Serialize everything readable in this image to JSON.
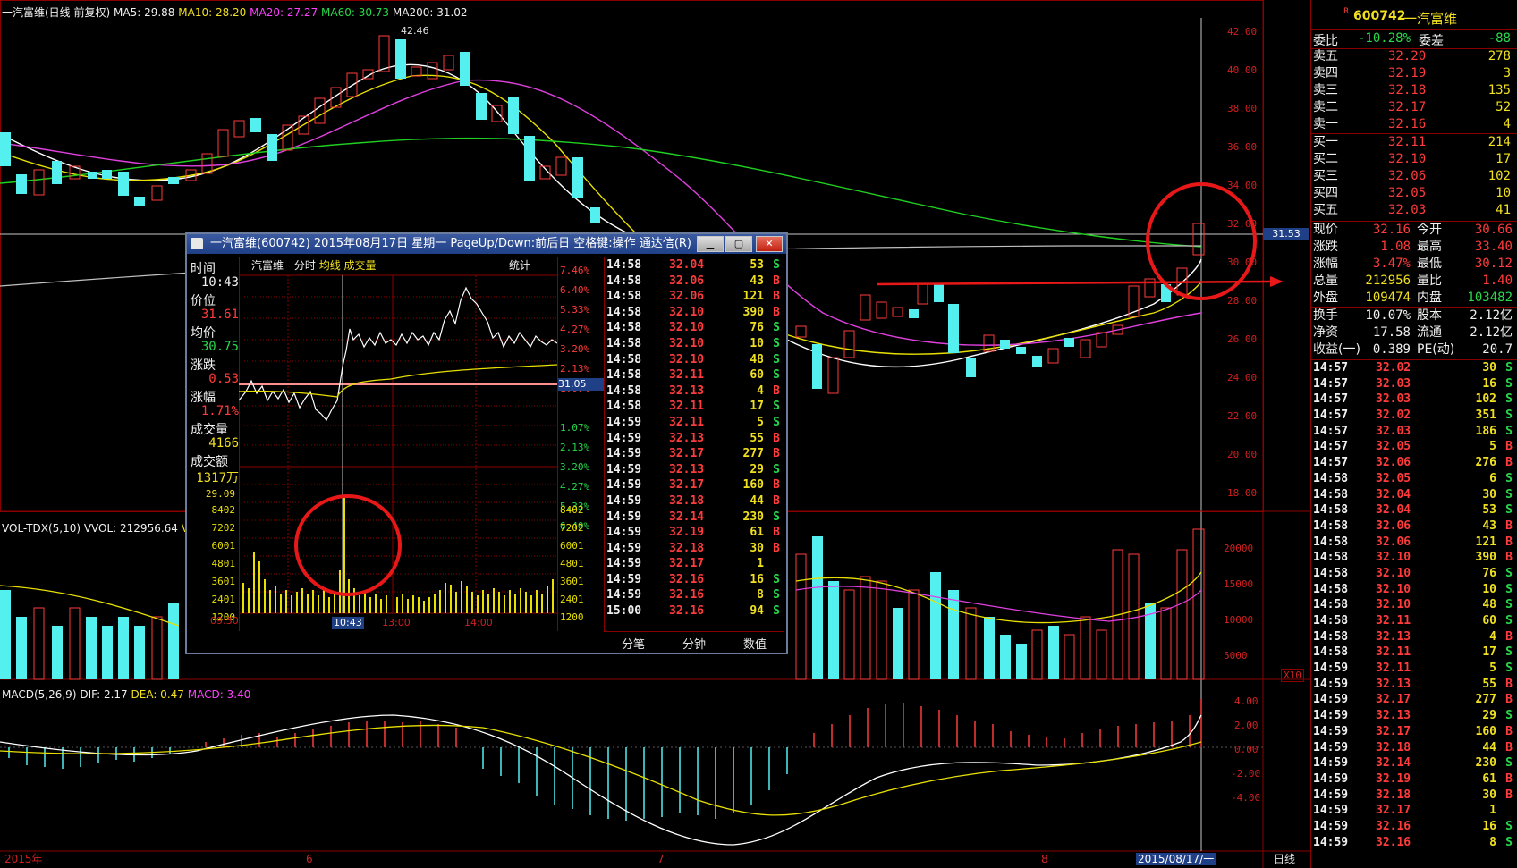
{
  "main_chart": {
    "legend_name": "一汽富维(日线 前复权)",
    "ma5": "MA5: 29.88",
    "ma10": "MA10: 28.20",
    "ma20": "MA20: 27.27",
    "ma60": "MA60: 30.73",
    "ma200": "MA200: 31.02",
    "high_marker": "42.46",
    "price_axis": [
      "42.00",
      "40.00",
      "38.00",
      "36.00",
      "34.00",
      "32.00",
      "30.00",
      "28.00",
      "26.00",
      "24.00",
      "22.00",
      "20.00",
      "18.00"
    ],
    "current_price_tag": "31.53"
  },
  "vol_chart": {
    "legend": "VOL-TDX(5,10)  VVOL: 212956.64",
    "legend_tail": "VO",
    "axis": [
      "20000",
      "15000",
      "10000",
      "5000"
    ],
    "unit": "X10"
  },
  "macd_chart": {
    "legend_name": "MACD(5,26,9)",
    "dif": "DIF: 2.17",
    "dea": "DEA: 0.47",
    "macd": "MACD: 3.40",
    "axis": [
      "4.00",
      "2.00",
      "0.00",
      "-2.00",
      "-4.00"
    ]
  },
  "date_axis": {
    "year": "2015年",
    "m6": "6",
    "m7": "7",
    "m8": "8",
    "cursor_date": "2015/08/17/一",
    "period": "日线"
  },
  "popup": {
    "title": "一汽富维(600742) 2015年08月17日 星期一 PageUp/Down:前后日 空格键:操作 通达信(R)",
    "header_name": "一汽富维",
    "header_tab1": "分时",
    "header_tab2": "均线",
    "header_tab3": "成交量",
    "header_stat": "统计",
    "side": {
      "time_label": "时间",
      "time_value": "10:43",
      "price_label": "价位",
      "price_value": "31.61",
      "avg_label": "均价",
      "avg_value": "30.75",
      "chg_label": "涨跌",
      "chg_value": "0.53",
      "pct_label": "涨幅",
      "pct_value": "1.71%",
      "vol_label": "成交量",
      "vol_value": "4166",
      "amt_label": "成交额",
      "amt_value": "1317万"
    },
    "right_pct_axis": [
      "7.46%",
      "6.40%",
      "5.33%",
      "4.27%",
      "3.20%",
      "2.13%",
      "1.07%",
      "",
      "1.07%",
      "2.13%",
      "3.20%",
      "4.27%",
      "5.33%",
      "6.40%"
    ],
    "left_price_axis": [
      "29.09"
    ],
    "prev_close_tag": "31.05",
    "vol_axis": [
      "8402",
      "7202",
      "6001",
      "4801",
      "3601",
      "2401",
      "1200"
    ],
    "time_axis": [
      "09:30",
      "10:43",
      "13:00",
      "14:00"
    ],
    "ticks": [
      {
        "t": "14:58",
        "p": "32.04",
        "v": "53",
        "d": "S"
      },
      {
        "t": "14:58",
        "p": "32.06",
        "v": "43",
        "d": "B"
      },
      {
        "t": "14:58",
        "p": "32.06",
        "v": "121",
        "d": "B"
      },
      {
        "t": "14:58",
        "p": "32.10",
        "v": "390",
        "d": "B"
      },
      {
        "t": "14:58",
        "p": "32.10",
        "v": "76",
        "d": "S"
      },
      {
        "t": "14:58",
        "p": "32.10",
        "v": "10",
        "d": "S"
      },
      {
        "t": "14:58",
        "p": "32.10",
        "v": "48",
        "d": "S"
      },
      {
        "t": "14:58",
        "p": "32.11",
        "v": "60",
        "d": "S"
      },
      {
        "t": "14:58",
        "p": "32.13",
        "v": "4",
        "d": "B"
      },
      {
        "t": "14:58",
        "p": "32.11",
        "v": "17",
        "d": "S"
      },
      {
        "t": "14:59",
        "p": "32.11",
        "v": "5",
        "d": "S"
      },
      {
        "t": "14:59",
        "p": "32.13",
        "v": "55",
        "d": "B"
      },
      {
        "t": "14:59",
        "p": "32.17",
        "v": "277",
        "d": "B"
      },
      {
        "t": "14:59",
        "p": "32.13",
        "v": "29",
        "d": "S"
      },
      {
        "t": "14:59",
        "p": "32.17",
        "v": "160",
        "d": "B"
      },
      {
        "t": "14:59",
        "p": "32.18",
        "v": "44",
        "d": "B"
      },
      {
        "t": "14:59",
        "p": "32.14",
        "v": "230",
        "d": "S"
      },
      {
        "t": "14:59",
        "p": "32.19",
        "v": "61",
        "d": "B"
      },
      {
        "t": "14:59",
        "p": "32.18",
        "v": "30",
        "d": "B"
      },
      {
        "t": "14:59",
        "p": "32.17",
        "v": "1",
        "d": ""
      },
      {
        "t": "14:59",
        "p": "32.16",
        "v": "16",
        "d": "S"
      },
      {
        "t": "14:59",
        "p": "32.16",
        "v": "8",
        "d": "S"
      },
      {
        "t": "15:00",
        "p": "32.16",
        "v": "94",
        "d": "S"
      }
    ],
    "tabs": [
      "分笔",
      "分钟",
      "数值"
    ]
  },
  "quote": {
    "code": "600742",
    "name": "一汽富维",
    "r_badge": "R",
    "webi_label": "委比",
    "webi_value": "-10.28%",
    "wecha_label": "委差",
    "wecha_value": "-88",
    "asks": [
      {
        "label": "卖五",
        "price": "32.20",
        "vol": "278"
      },
      {
        "label": "卖四",
        "price": "32.19",
        "vol": "3"
      },
      {
        "label": "卖三",
        "price": "32.18",
        "vol": "135"
      },
      {
        "label": "卖二",
        "price": "32.17",
        "vol": "52"
      },
      {
        "label": "卖一",
        "price": "32.16",
        "vol": "4"
      }
    ],
    "bids": [
      {
        "label": "买一",
        "price": "32.11",
        "vol": "214"
      },
      {
        "label": "买二",
        "price": "32.10",
        "vol": "17"
      },
      {
        "label": "买三",
        "price": "32.06",
        "vol": "102"
      },
      {
        "label": "买四",
        "price": "32.05",
        "vol": "10"
      },
      {
        "label": "买五",
        "price": "32.03",
        "vol": "41"
      }
    ],
    "stats": [
      {
        "l1": "现价",
        "v1": "32.16",
        "l2": "今开",
        "v2": "30.66"
      },
      {
        "l1": "涨跌",
        "v1": "1.08",
        "l2": "最高",
        "v2": "33.40"
      },
      {
        "l1": "涨幅",
        "v1": "3.47%",
        "l2": "最低",
        "v2": "30.12"
      },
      {
        "l1": "总量",
        "v1": "212956",
        "l2": "量比",
        "v2": "1.40"
      },
      {
        "l1": "外盘",
        "v1": "109474",
        "l2": "内盘",
        "v2": "103482"
      }
    ],
    "stats2": [
      {
        "l1": "换手",
        "v1": "10.07%",
        "l2": "股本",
        "v2": "2.12亿"
      },
      {
        "l1": "净资",
        "v1": "17.58",
        "l2": "流通",
        "v2": "2.12亿"
      },
      {
        "l1": "收益(一)",
        "v1": "0.389",
        "l2": "PE(动)",
        "v2": "20.7"
      }
    ],
    "ticks": [
      {
        "t": "14:57",
        "p": "32.02",
        "v": "30",
        "d": "S"
      },
      {
        "t": "14:57",
        "p": "32.03",
        "v": "16",
        "d": "S"
      },
      {
        "t": "14:57",
        "p": "32.03",
        "v": "102",
        "d": "S"
      },
      {
        "t": "14:57",
        "p": "32.02",
        "v": "351",
        "d": "S"
      },
      {
        "t": "14:57",
        "p": "32.03",
        "v": "186",
        "d": "S"
      },
      {
        "t": "14:57",
        "p": "32.05",
        "v": "5",
        "d": "B"
      },
      {
        "t": "14:57",
        "p": "32.06",
        "v": "276",
        "d": "B"
      },
      {
        "t": "14:58",
        "p": "32.05",
        "v": "6",
        "d": "S"
      },
      {
        "t": "14:58",
        "p": "32.04",
        "v": "30",
        "d": "S"
      },
      {
        "t": "14:58",
        "p": "32.04",
        "v": "53",
        "d": "S"
      },
      {
        "t": "14:58",
        "p": "32.06",
        "v": "43",
        "d": "B"
      },
      {
        "t": "14:58",
        "p": "32.06",
        "v": "121",
        "d": "B"
      },
      {
        "t": "14:58",
        "p": "32.10",
        "v": "390",
        "d": "B"
      },
      {
        "t": "14:58",
        "p": "32.10",
        "v": "76",
        "d": "S"
      },
      {
        "t": "14:58",
        "p": "32.10",
        "v": "10",
        "d": "S"
      },
      {
        "t": "14:58",
        "p": "32.10",
        "v": "48",
        "d": "S"
      },
      {
        "t": "14:58",
        "p": "32.11",
        "v": "60",
        "d": "S"
      },
      {
        "t": "14:58",
        "p": "32.13",
        "v": "4",
        "d": "B"
      },
      {
        "t": "14:58",
        "p": "32.11",
        "v": "17",
        "d": "S"
      },
      {
        "t": "14:59",
        "p": "32.11",
        "v": "5",
        "d": "S"
      },
      {
        "t": "14:59",
        "p": "32.13",
        "v": "55",
        "d": "B"
      },
      {
        "t": "14:59",
        "p": "32.17",
        "v": "277",
        "d": "B"
      },
      {
        "t": "14:59",
        "p": "32.13",
        "v": "29",
        "d": "S"
      },
      {
        "t": "14:59",
        "p": "32.17",
        "v": "160",
        "d": "B"
      },
      {
        "t": "14:59",
        "p": "32.18",
        "v": "44",
        "d": "B"
      },
      {
        "t": "14:59",
        "p": "32.14",
        "v": "230",
        "d": "S"
      },
      {
        "t": "14:59",
        "p": "32.19",
        "v": "61",
        "d": "B"
      },
      {
        "t": "14:59",
        "p": "32.18",
        "v": "30",
        "d": "B"
      },
      {
        "t": "14:59",
        "p": "32.17",
        "v": "1",
        "d": ""
      },
      {
        "t": "14:59",
        "p": "32.16",
        "v": "16",
        "d": "S"
      },
      {
        "t": "14:59",
        "p": "32.16",
        "v": "8",
        "d": "S"
      }
    ]
  },
  "colors": {
    "up": "#ff3b3b",
    "down": "#54f0f0",
    "ma5": "#ffffff",
    "ma10": "#e8e000",
    "ma20": "#e040e0",
    "ma60": "#20d020",
    "ma200": "#c0c0c0",
    "grid": "#8a0000"
  }
}
